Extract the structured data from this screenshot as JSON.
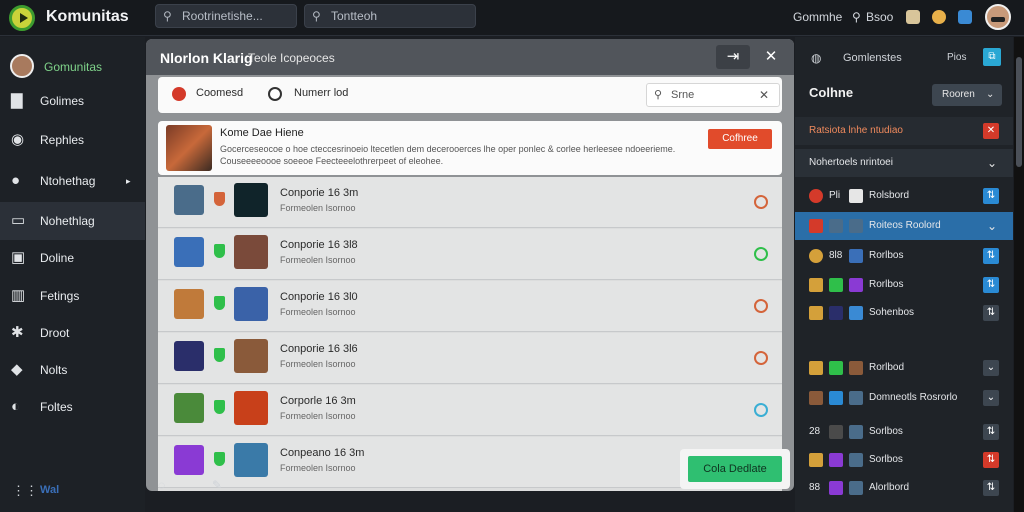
{
  "topbar": {
    "app_title": "Komunitas",
    "search1": "Rootrinetishe...",
    "search2": "Tontteoh",
    "right_label": "Gommhe",
    "right_label2": "Bsoo"
  },
  "sidebar": {
    "user_name": "Gomunitas",
    "items": [
      {
        "label": "Golimes",
        "icon": "document-icon"
      },
      {
        "label": "Rephles",
        "icon": "gamepad-icon"
      },
      {
        "label": "Ntohethag",
        "icon": "person-icon"
      },
      {
        "label": "Nohethlag",
        "icon": "window-icon"
      },
      {
        "label": "Doline",
        "icon": "image-icon"
      },
      {
        "label": "Fetings",
        "icon": "chart-icon"
      },
      {
        "label": "Droot",
        "icon": "gear-icon"
      },
      {
        "label": "Nolts",
        "icon": "bell-icon"
      },
      {
        "label": "Foltes",
        "icon": "globe-icon"
      }
    ],
    "footer": "Wal"
  },
  "dialog": {
    "title": "Nlorlon Klarig",
    "subtitle": "Teole Icopeoces",
    "filter": {
      "chip1": "Coomesd",
      "chip2": "Numerr lod",
      "search_placeholder": "Srne"
    },
    "featured": {
      "title": "Kome Dae Hiene",
      "description": "Gocerceseocoe o hoe cteccesrinoeio ltecetlen dem decerooerces lhe oper ponlec & corlee herleesee ndoeerieme. Couseeeeoooe soeeoe Feecteeelothrerpeet of eleohee.",
      "button": "Cofhree"
    },
    "rows": [
      {
        "title": "Conporie 16 3m",
        "sub": "Formeolen Isornoo",
        "t1": "#4a6c8a",
        "shield": "#d4643a",
        "t2": "#10242a",
        "ring": "#d4643a"
      },
      {
        "title": "Conporie 16 3l8",
        "sub": "Formeolen Isornoo",
        "t1": "#3a6fb8",
        "shield": "#2fbf4a",
        "t2": "#7a4a3a",
        "ring": "#2fbf4a"
      },
      {
        "title": "Conporie 16 3l0",
        "sub": "Formeolen Isornoo",
        "t1": "#c07a3a",
        "shield": "#2fbf4a",
        "t2": "#3a62a8",
        "ring": "#d4643a"
      },
      {
        "title": "Conporie 16 3l6",
        "sub": "Formeolen Isornoo",
        "t1": "#2a2e6a",
        "shield": "#2fbf4a",
        "t2": "#8a5a3a",
        "ring": "#d4643a"
      },
      {
        "title": "Corporle 16 3m",
        "sub": "Formeolen Isornoo",
        "t1": "#4a8a3a",
        "shield": "#2fbf4a",
        "t2": "#c8401a",
        "ring": "#3aaed4"
      },
      {
        "title": "Conpeano 16 3m",
        "sub": "Formeolen Isornoo",
        "t1": "#8a3ad4",
        "shield": "#2fbf4a",
        "t2": "#3a7aa8",
        "ring": "#d4643a"
      }
    ],
    "cta_button": "Cola Dedlate"
  },
  "rpanel": {
    "head_label": "Gomlenstes",
    "head_badge": "Pios",
    "title": "Colhne",
    "select": "Rooren",
    "banner": "Ratsiota lnhe ntudiao",
    "section": "Nohertoels nrintoei",
    "rows": [
      {
        "label": "Rolsbord",
        "b1": "#d43a2a",
        "b2": "#e6e6e6",
        "b3": "#e6e6e6",
        "act": "#2a8ad4",
        "pre": "Pli"
      },
      {
        "label": "Roiteos Roolord",
        "b1": "#d43a2a",
        "b2": "#4a6c8a",
        "b3": "#4a6c8a",
        "act": "",
        "pre": "",
        "hl": true
      },
      {
        "label": "Rorlbos",
        "b1": "#d4a03a",
        "b2": "#1a1a1a",
        "b3": "#3a6fb8",
        "act": "#2a8ad4",
        "pre": "8l8"
      },
      {
        "label": "Rorlbos",
        "b1": "#d4a03a",
        "b2": "#2fbf4a",
        "b3": "#8a3ad4",
        "act": "#2a8ad4",
        "pre": ""
      },
      {
        "label": "Sohenbos",
        "b1": "#d4a03a",
        "b2": "#2a2e6a",
        "b3": "#3a8ad4",
        "act": "#3d4650",
        "pre": ""
      },
      {
        "label": "Rorlbod",
        "b1": "#d4a03a",
        "b2": "#2fbf4a",
        "b3": "#8a5a3a",
        "act": "#3d4650",
        "pre": ""
      },
      {
        "label": "Domneotls Rosrorlo",
        "b1": "#8a5a3a",
        "b2": "#2a8ad4",
        "b3": "#4a6c8a",
        "act": "#3d4650",
        "pre": ""
      },
      {
        "label": "Sorlbos",
        "b1": "#1a1a1a",
        "b2": "#4a4a4a",
        "b3": "#4a6c8a",
        "act": "#3d4650",
        "pre": "28"
      },
      {
        "label": "Sorlbos",
        "b1": "#d4a03a",
        "b2": "#8a3ad4",
        "b3": "#4a6c8a",
        "act": "#d43a2a",
        "pre": ""
      },
      {
        "label": "Alorlbord",
        "b1": "#1a1a1a",
        "b2": "#8a3ad4",
        "b3": "#4a6c8a",
        "act": "#3d4650",
        "pre": "88"
      }
    ]
  }
}
